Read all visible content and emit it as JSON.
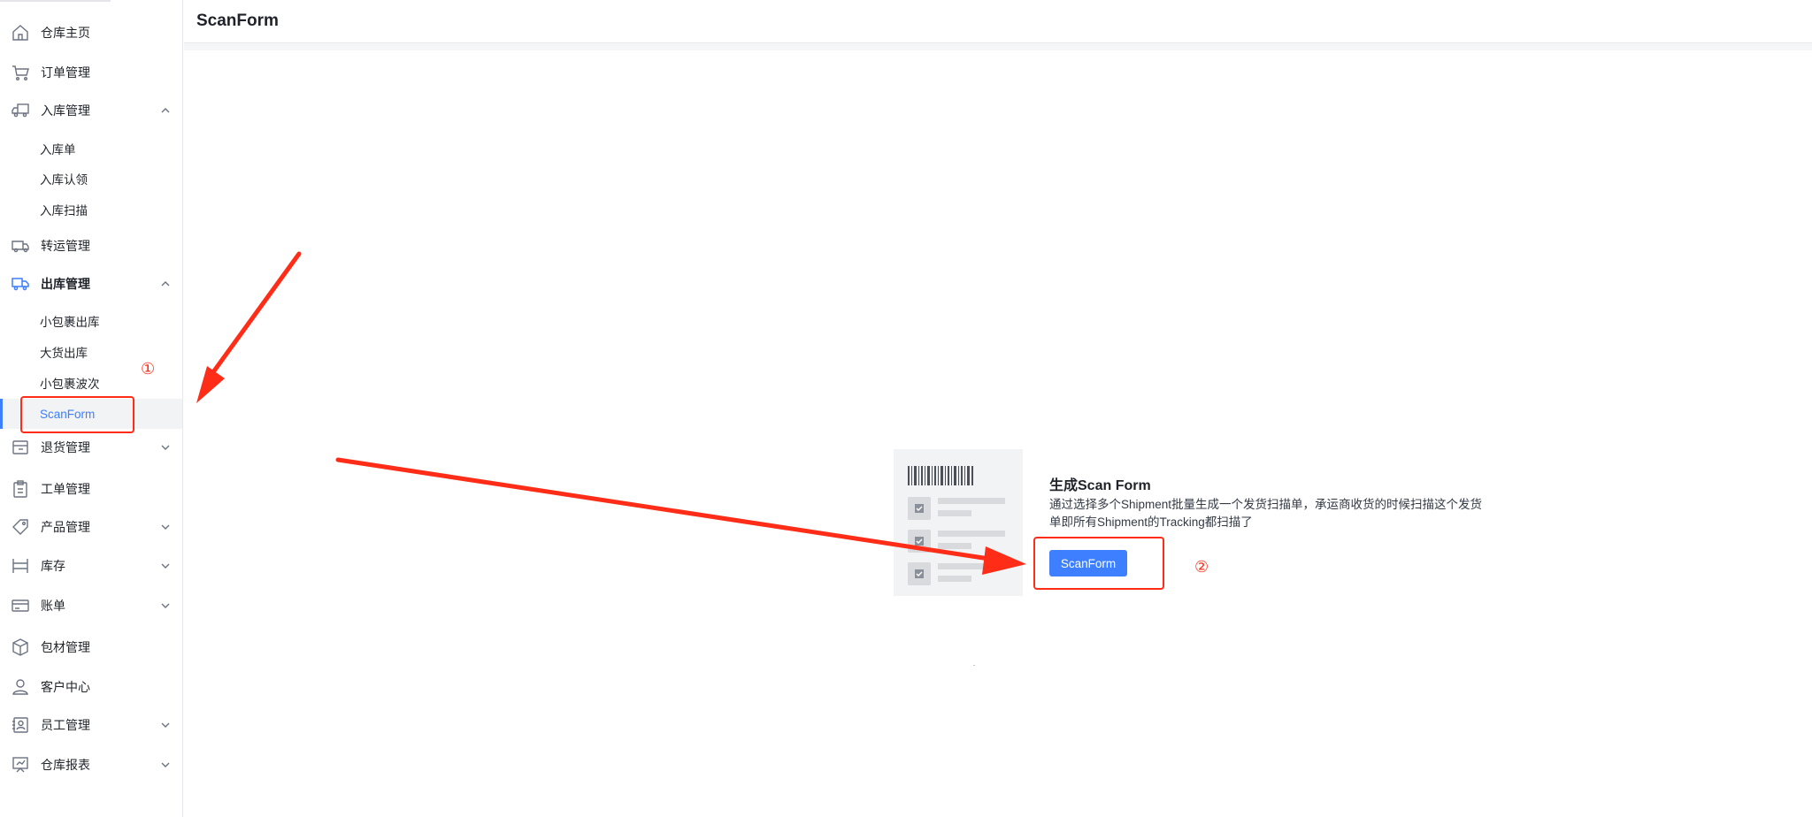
{
  "header": {
    "title": "ScanForm"
  },
  "sidebar": {
    "items": [
      {
        "label": "仓库主页",
        "icon": "home-icon"
      },
      {
        "label": "订单管理",
        "icon": "cart-icon"
      },
      {
        "label": "入库管理",
        "icon": "truck-inbound-icon",
        "expanded": true,
        "children": [
          {
            "label": "入库单"
          },
          {
            "label": "入库认领"
          },
          {
            "label": "入库扫描"
          }
        ]
      },
      {
        "label": "转运管理",
        "icon": "transfer-truck-icon"
      },
      {
        "label": "出库管理",
        "icon": "truck-outbound-icon",
        "expanded": true,
        "children": [
          {
            "label": "小包裹出库"
          },
          {
            "label": "大货出库"
          },
          {
            "label": "小包裹波次"
          },
          {
            "label": "ScanForm",
            "selected": true
          }
        ]
      },
      {
        "label": "退货管理",
        "icon": "return-icon",
        "expanded": false
      },
      {
        "label": "工单管理",
        "icon": "clipboard-icon"
      },
      {
        "label": "产品管理",
        "icon": "tag-icon",
        "expanded": false
      },
      {
        "label": "库存",
        "icon": "shelf-icon",
        "expanded": false
      },
      {
        "label": "账单",
        "icon": "card-icon",
        "expanded": false
      },
      {
        "label": "包材管理",
        "icon": "box-icon"
      },
      {
        "label": "客户中心",
        "icon": "user-icon"
      },
      {
        "label": "员工管理",
        "icon": "contacts-icon",
        "expanded": false
      },
      {
        "label": "仓库报表",
        "icon": "report-icon",
        "expanded": false
      }
    ]
  },
  "empty_state": {
    "title": "生成Scan Form",
    "description": "通过选择多个Shipment批量生成一个发货扫描单，承运商收货的时候扫描这个发货单即所有Shipment的Tracking都扫描了",
    "button_label": "ScanForm"
  },
  "annotations": {
    "marker_1": "①",
    "marker_2": "②",
    "color": "#ff2d17"
  },
  "colors": {
    "accent": "#3d7fff",
    "text": "#1f2329",
    "border": "#e6e8eb"
  }
}
